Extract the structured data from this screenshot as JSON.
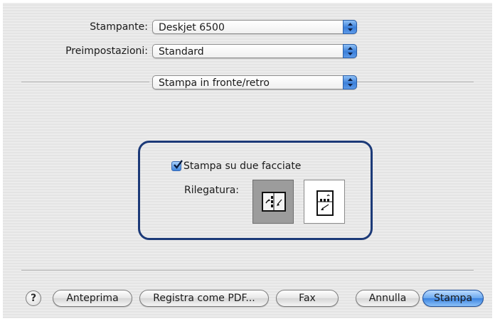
{
  "printer": {
    "label": "Stampante:",
    "value": "Deskjet 6500"
  },
  "presets": {
    "label": "Preimpostazioni:",
    "value": "Standard"
  },
  "pane": {
    "value": "Stampa in fronte/retro"
  },
  "duplex": {
    "checkbox_label": "Stampa su due facciate",
    "checked": true,
    "binding_label": "Rilegatura:",
    "options": [
      {
        "name": "long-edge",
        "selected": true
      },
      {
        "name": "short-edge",
        "selected": false
      }
    ]
  },
  "footer": {
    "help_symbol": "?",
    "preview_label": "Anteprima",
    "save_pdf_label": "Registra come PDF...",
    "fax_label": "Fax",
    "cancel_label": "Annulla",
    "print_label": "Stampa"
  },
  "colors": {
    "frame": "#1c3a78",
    "accent": "#3b82e0"
  }
}
